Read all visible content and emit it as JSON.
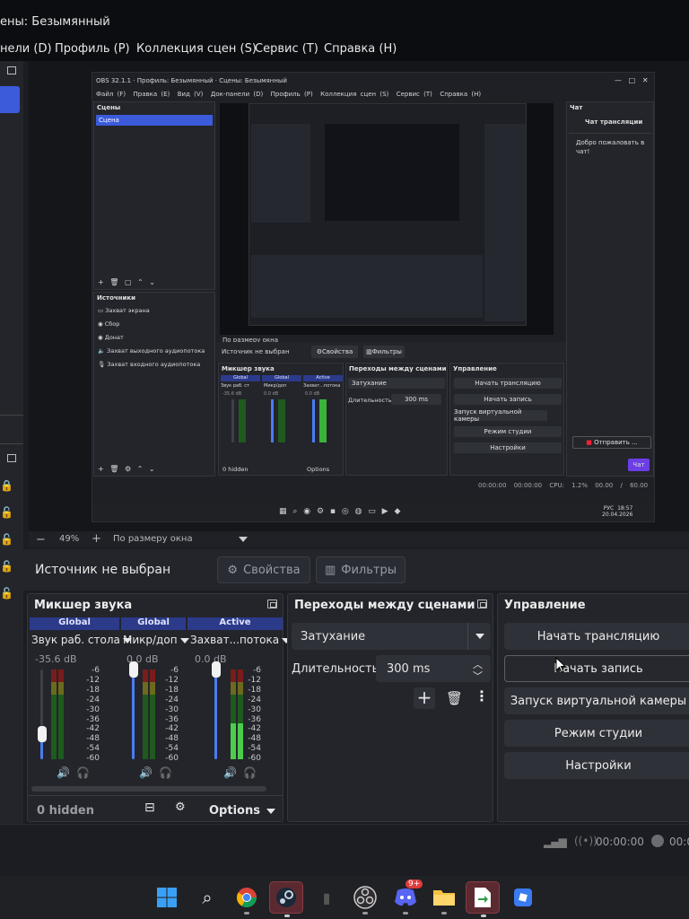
{
  "window": {
    "title": "ены: Безымянный"
  },
  "menu": [
    "нели (D)",
    "Профиль (P)",
    "Коллекция сцен (S)",
    "Сервис (T)",
    "Справка (H)"
  ],
  "nested": {
    "title": "OBS 32.1.1 · Профиль: Безымянный · Сцены: Безымянный",
    "menu": [
      "Файл (F)",
      "Правка (E)",
      "Вид (V)",
      "Док-панели (D)",
      "Профиль (P)",
      "Коллекция сцен (S)",
      "Сервис (T)",
      "Справка (H)"
    ],
    "scenes_title": "Сцены",
    "scene_item": "Сцена",
    "sources_title": "Источники",
    "sources": [
      "Захват экрана",
      "Сбор",
      "Донат",
      "Захват выходного аудиопотока",
      "Захват входного аудиопотока"
    ],
    "chat_title": "Чат",
    "chat_sub": "Чат трансляции",
    "chat_welcome": "Добро пожаловать в чат!",
    "chat_send": "Отправить ...",
    "chat_button": "Чат",
    "no_source": "Источник не выбран",
    "props": "Свойства",
    "filters": "Фильтры",
    "zoom": "По размеру окна",
    "mixer_title": "Микшер звука",
    "mixer_hdrs": [
      "Global",
      "Global",
      "Active"
    ],
    "mixer_names": [
      "Звук раб. ст",
      "Микр/доп",
      "Захват...потока"
    ],
    "mixer_db": [
      "-35.6 dB",
      "0.0 dB",
      "0.0 dB"
    ],
    "hidden": "0 hidden",
    "options": "Options",
    "transitions_title": "Переходы между сценами",
    "transition": "Затухание",
    "duration_label": "Длительность",
    "duration": "300 ms",
    "controls_title": "Управление",
    "controls": [
      "Начать трансляцию",
      "Начать запись",
      "Запуск виртуальной камеры",
      "Режим студии",
      "Настройки"
    ],
    "status": [
      "00:00:00",
      "00:00:00",
      "CPU: 1.2%",
      "00.00 / 60.00 FPS"
    ],
    "tray_lang": "РУС",
    "tray_time": "18:57",
    "tray_date": "20.04.2026"
  },
  "zoombar": {
    "zoom": "49%",
    "fit": "По размеру окна"
  },
  "source": {
    "none": "Источник не выбран",
    "props": "Свойства",
    "filters": "Фильтры"
  },
  "mixer": {
    "title": "Микшер звука",
    "channels": [
      {
        "header": "Global",
        "header_color": "#2c3a8a",
        "name": "Звук раб. стола",
        "db": "-35.6 dB",
        "fader_level": 0.28,
        "meter_level": 0.0
      },
      {
        "header": "Global",
        "header_color": "#2c3a8a",
        "name": "Микр/доп",
        "db": "0.0 dB",
        "fader_level": 1.0,
        "meter_level": 0.0
      },
      {
        "header": "Active",
        "header_color": "#2c3a8a",
        "name": "Захват...потока",
        "db": "0.0 dB",
        "fader_level": 1.0,
        "meter_level": 0.4
      }
    ],
    "scale": [
      "-6",
      "-12",
      "-18",
      "-24",
      "-30",
      "-36",
      "-42",
      "-48",
      "-54",
      "-60"
    ],
    "hidden": "0 hidden",
    "options": "Options"
  },
  "transitions": {
    "title": "Переходы между сценами",
    "selected": "Затухание",
    "duration_label": "Длительность",
    "duration": "300 ms"
  },
  "controls": {
    "title": "Управление",
    "buttons": [
      "Начать трансляцию",
      "Начать запись",
      "Запуск виртуальной камеры",
      "Режим студии",
      "Настройки"
    ]
  },
  "status": {
    "stream_time": "00:00:00",
    "rec_time": "00:0"
  },
  "taskbar": {
    "icons": [
      "start-icon",
      "search-icon",
      "chrome-icon",
      "steam-icon",
      "game-icon",
      "obs-icon",
      "discord-icon",
      "explorer-icon",
      "app-icon",
      "roblox-icon"
    ],
    "discord_badge": "9+"
  }
}
